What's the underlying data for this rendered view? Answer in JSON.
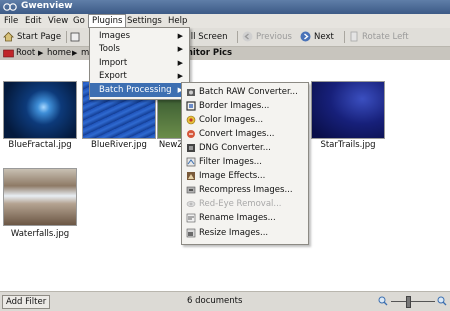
{
  "window": {
    "title": "Gwenview"
  },
  "menubar": {
    "items": [
      "File",
      "Edit",
      "View",
      "Go",
      "Plugins",
      "Settings",
      "Help"
    ]
  },
  "toolbar": {
    "start_page": "Start Page",
    "full_screen": "Full Screen",
    "previous": "Previous",
    "next": "Next",
    "rotate_left": "Rotate Left"
  },
  "breadcrumb": {
    "root": "Root",
    "home": "home",
    "partial": "m",
    "current": "Monitor Pics",
    "current_visible": "onitor Pics"
  },
  "thumbnails": [
    {
      "name": "BlueFractal.jpg"
    },
    {
      "name": "BlueRiver.jpg"
    },
    {
      "name": "NewZ"
    },
    {
      "name": "StarTrails.jpg"
    },
    {
      "name": "Waterfalls.jpg"
    }
  ],
  "plugins_menu": {
    "items": [
      "Images",
      "Tools",
      "Import",
      "Export",
      "Batch Processing"
    ],
    "highlighted": "Batch Processing"
  },
  "batch_menu": {
    "items": [
      {
        "label": "Batch RAW Converter...",
        "icon": "raw-icon",
        "enabled": true
      },
      {
        "label": "Border Images...",
        "icon": "border-icon",
        "enabled": true
      },
      {
        "label": "Color Images...",
        "icon": "color-icon",
        "enabled": true
      },
      {
        "label": "Convert Images...",
        "icon": "convert-icon",
        "enabled": true
      },
      {
        "label": "DNG Converter...",
        "icon": "dng-icon",
        "enabled": true
      },
      {
        "label": "Filter Images...",
        "icon": "filter-icon",
        "enabled": true
      },
      {
        "label": "Image Effects...",
        "icon": "effects-icon",
        "enabled": true
      },
      {
        "label": "Recompress Images...",
        "icon": "recompress-icon",
        "enabled": true
      },
      {
        "label": "Red-Eye Removal...",
        "icon": "redeye-icon",
        "enabled": false
      },
      {
        "label": "Rename Images...",
        "icon": "rename-icon",
        "enabled": true
      },
      {
        "label": "Resize Images...",
        "icon": "resize-icon",
        "enabled": true
      }
    ]
  },
  "statusbar": {
    "add_filter": "Add Filter",
    "document_count": "6 documents"
  },
  "colors": {
    "highlight": "#3d6fb2",
    "titlebar": "#4a6a96"
  }
}
